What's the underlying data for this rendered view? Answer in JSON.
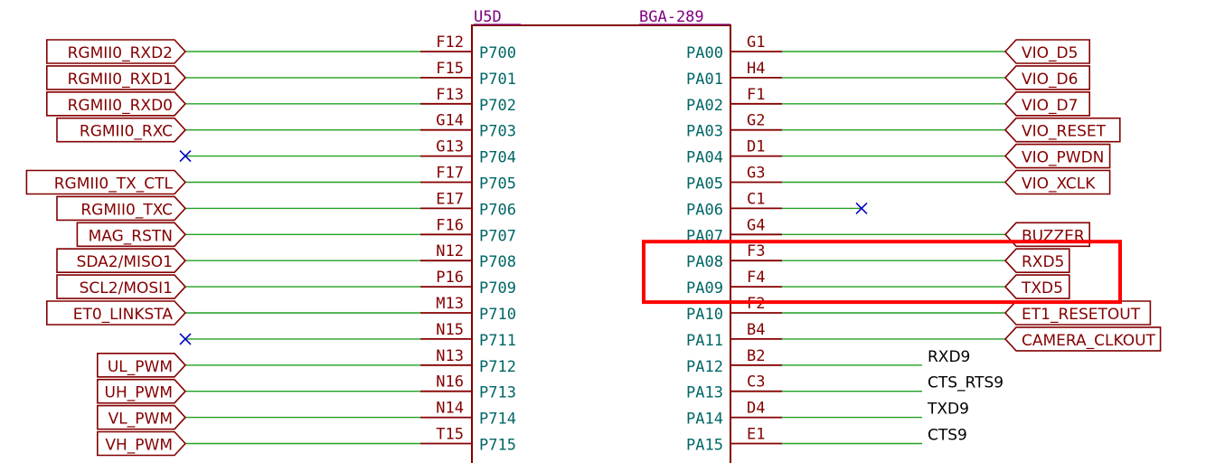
{
  "component": {
    "reference": "U5D",
    "package": "BGA-289"
  },
  "colors": {
    "body_outline": "#840000",
    "pin_name": "#006666",
    "pin_number": "#840000",
    "wire": "#22a022",
    "label": "#840000",
    "no_connect": "#0000c8",
    "plain_text": "#000000",
    "highlight": "#ff0000"
  },
  "left_pins": [
    {
      "number": "F12",
      "name": "P700",
      "net": "RGMII0_RXD2",
      "nc": false
    },
    {
      "number": "F15",
      "name": "P701",
      "net": "RGMII0_RXD1",
      "nc": false
    },
    {
      "number": "F13",
      "name": "P702",
      "net": "RGMII0_RXD0",
      "nc": false
    },
    {
      "number": "G14",
      "name": "P703",
      "net": "RGMII0_RXC",
      "nc": false
    },
    {
      "number": "G13",
      "name": "P704",
      "net": "",
      "nc": true
    },
    {
      "number": "F17",
      "name": "P705",
      "net": "RGMII0_TX_CTL",
      "nc": false
    },
    {
      "number": "E17",
      "name": "P706",
      "net": "RGMII0_TXC",
      "nc": false
    },
    {
      "number": "F16",
      "name": "P707",
      "net": "MAG_RSTN",
      "nc": false
    },
    {
      "number": "N12",
      "name": "P708",
      "net": "SDA2/MISO1",
      "nc": false
    },
    {
      "number": "P16",
      "name": "P709",
      "net": "SCL2/MOSI1",
      "nc": false
    },
    {
      "number": "M13",
      "name": "P710",
      "net": "ET0_LINKSTA",
      "nc": false
    },
    {
      "number": "N15",
      "name": "P711",
      "net": "",
      "nc": true
    },
    {
      "number": "N13",
      "name": "P712",
      "net": "UL_PWM",
      "nc": false
    },
    {
      "number": "N16",
      "name": "P713",
      "net": "UH_PWM",
      "nc": false
    },
    {
      "number": "N14",
      "name": "P714",
      "net": "VL_PWM",
      "nc": false
    },
    {
      "number": "T15",
      "name": "P715",
      "net": "VH_PWM",
      "nc": false
    }
  ],
  "right_pins": [
    {
      "number": "G1",
      "name": "PA00",
      "net": "VIO_D5",
      "kind": "label"
    },
    {
      "number": "H4",
      "name": "PA01",
      "net": "VIO_D6",
      "kind": "label"
    },
    {
      "number": "F1",
      "name": "PA02",
      "net": "VIO_D7",
      "kind": "label"
    },
    {
      "number": "G2",
      "name": "PA03",
      "net": "VIO_RESET",
      "kind": "label"
    },
    {
      "number": "D1",
      "name": "PA04",
      "net": "VIO_PWDN",
      "kind": "label"
    },
    {
      "number": "G3",
      "name": "PA05",
      "net": "VIO_XCLK",
      "kind": "label"
    },
    {
      "number": "C1",
      "name": "PA06",
      "net": "",
      "kind": "nc"
    },
    {
      "number": "G4",
      "name": "PA07",
      "net": "BUZZER",
      "kind": "label"
    },
    {
      "number": "F3",
      "name": "PA08",
      "net": "RXD5",
      "kind": "label"
    },
    {
      "number": "F4",
      "name": "PA09",
      "net": "TXD5",
      "kind": "label"
    },
    {
      "number": "F2",
      "name": "PA10",
      "net": "ET1_RESETOUT",
      "kind": "label"
    },
    {
      "number": "B4",
      "name": "PA11",
      "net": "CAMERA_CLKOUT",
      "kind": "label"
    },
    {
      "number": "B2",
      "name": "PA12",
      "net": "RXD9",
      "kind": "text"
    },
    {
      "number": "C3",
      "name": "PA13",
      "net": "CTS_RTS9",
      "kind": "text"
    },
    {
      "number": "D4",
      "name": "PA14",
      "net": "TXD9",
      "kind": "text"
    },
    {
      "number": "E1",
      "name": "PA15",
      "net": "CTS9",
      "kind": "text"
    }
  ]
}
